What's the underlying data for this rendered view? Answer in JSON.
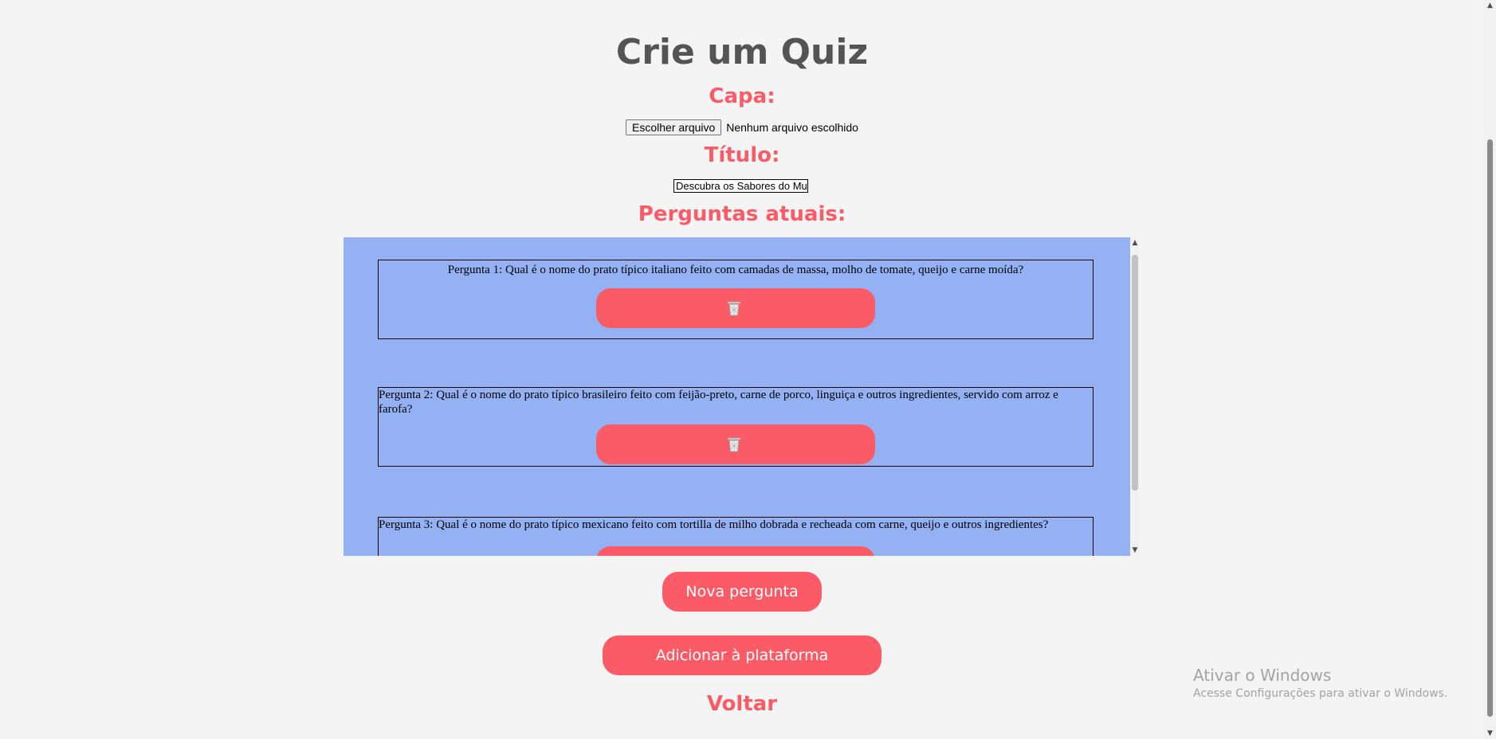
{
  "header": {
    "title": "Crie um Quiz"
  },
  "cover": {
    "label": "Capa:",
    "file_button": "Escolher arquivo",
    "file_status": "Nenhum arquivo escolhido"
  },
  "title_field": {
    "label": "Título:",
    "value": "Descubra os Sabores do Mu"
  },
  "questions": {
    "label": "Perguntas atuais:",
    "items": [
      {
        "text": "Pergunta 1: Qual é o nome do prato típico italiano feito com camadas de massa, molho de tomate, queijo e carne moída?"
      },
      {
        "text": "Pergunta 2: Qual é o nome do prato típico brasileiro feito com feijão-preto, carne de porco, linguiça e outros ingredientes, servido com arroz e farofa?"
      },
      {
        "text": "Pergunta 3: Qual é o nome do prato típico mexicano feito com tortilla de milho dobrada e recheada com carne, queijo e outros ingredientes?"
      }
    ]
  },
  "actions": {
    "new_question": "Nova pergunta",
    "add_to_platform": "Adicionar à plataforma",
    "back": "Voltar"
  },
  "watermark": {
    "title": "Ativar o Windows",
    "subtitle": "Acesse Configurações para ativar o Windows."
  },
  "colors": {
    "accent": "#fb5b67",
    "panel": "#93b1f3",
    "background": "#f4f4f4",
    "heading": "#545454"
  },
  "icons": {
    "delete": "trash-icon"
  }
}
